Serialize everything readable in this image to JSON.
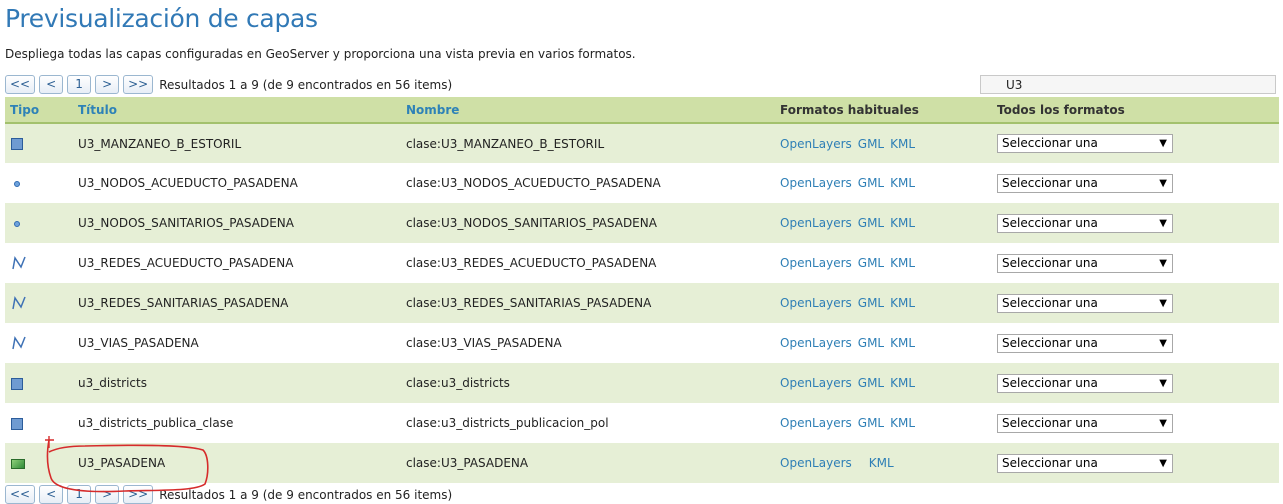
{
  "page": {
    "title": "Previsualización de capas",
    "description": "Despliega todas las capas configuradas en GeoServer y proporciona una vista previa en varios formatos."
  },
  "pager": {
    "first": "<<",
    "prev": "<",
    "page": "1",
    "next": ">",
    "last": ">>",
    "results": "Resultados 1 a 9 (de 9 encontrados en 56 items)"
  },
  "filter": {
    "value": "U3"
  },
  "table": {
    "headers": {
      "tipo": "Tipo",
      "titulo": "Título",
      "nombre": "Nombre",
      "formatos_habituales": "Formatos habituales",
      "todos_formatos": "Todos los formatos"
    },
    "rows": [
      {
        "type_icon": "polygon-icon",
        "title": "U3_MANZANEO_B_ESTORIL",
        "name": "clase:U3_MANZANEO_B_ESTORIL",
        "formats": [
          "OpenLayers",
          "GML",
          "KML"
        ],
        "select": "Seleccionar una"
      },
      {
        "type_icon": "point-icon",
        "title": "U3_NODOS_ACUEDUCTO_PASADENA",
        "name": "clase:U3_NODOS_ACUEDUCTO_PASADENA",
        "formats": [
          "OpenLayers",
          "GML",
          "KML"
        ],
        "select": "Seleccionar una"
      },
      {
        "type_icon": "point-icon",
        "title": "U3_NODOS_SANITARIOS_PASADENA",
        "name": "clase:U3_NODOS_SANITARIOS_PASADENA",
        "formats": [
          "OpenLayers",
          "GML",
          "KML"
        ],
        "select": "Seleccionar una"
      },
      {
        "type_icon": "line-icon",
        "title": "U3_REDES_ACUEDUCTO_PASADENA",
        "name": "clase:U3_REDES_ACUEDUCTO_PASADENA",
        "formats": [
          "OpenLayers",
          "GML",
          "KML"
        ],
        "select": "Seleccionar una"
      },
      {
        "type_icon": "line-icon",
        "title": "U3_REDES_SANITARIAS_PASADENA",
        "name": "clase:U3_REDES_SANITARIAS_PASADENA",
        "formats": [
          "OpenLayers",
          "GML",
          "KML"
        ],
        "select": "Seleccionar una"
      },
      {
        "type_icon": "line-icon",
        "title": "U3_VIAS_PASADENA",
        "name": "clase:U3_VIAS_PASADENA",
        "formats": [
          "OpenLayers",
          "GML",
          "KML"
        ],
        "select": "Seleccionar una"
      },
      {
        "type_icon": "polygon-icon",
        "title": "u3_districts",
        "name": "clase:u3_districts",
        "formats": [
          "OpenLayers",
          "GML",
          "KML"
        ],
        "select": "Seleccionar una"
      },
      {
        "type_icon": "polygon-icon",
        "title": "u3_districts_publica_clase",
        "name": "clase:u3_districts_publicacion_pol",
        "formats": [
          "OpenLayers",
          "GML",
          "KML"
        ],
        "select": "Seleccionar una"
      },
      {
        "type_icon": "raster-icon",
        "title": "U3_PASADENA",
        "name": "clase:U3_PASADENA",
        "formats": [
          "OpenLayers",
          "KML"
        ],
        "select": "Seleccionar una"
      }
    ]
  },
  "colors": {
    "accent": "#3179b6",
    "header_bg": "#cfe0a6",
    "row_alt_bg": "#e6efd6",
    "annotation": "#d62b2b"
  }
}
